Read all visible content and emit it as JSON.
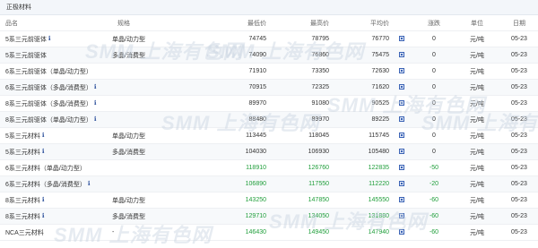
{
  "section": {
    "title": "正极材料"
  },
  "table": {
    "headers": [
      "品名",
      "规格",
      "最低价",
      "最高价",
      "平均价",
      "",
      "涨跌",
      "单位",
      "日期"
    ],
    "icons": {
      "info": "info-icon",
      "chart": "chart-icon"
    },
    "rows": [
      {
        "name": "5系三元前驱体",
        "info": true,
        "spec": "单晶/动力型",
        "low": "74745",
        "high": "78795",
        "avg": "76770",
        "change": "0",
        "unit": "元/吨",
        "date": "05-23",
        "up": false
      },
      {
        "name": "5系三元前驱体",
        "info": false,
        "spec": "多晶/消费型",
        "low": "74090",
        "high": "76860",
        "avg": "75475",
        "change": "0",
        "unit": "元/吨",
        "date": "05-23",
        "up": false
      },
      {
        "name": "6系三元前驱体（单晶/动力型）",
        "info": false,
        "spec": "",
        "low": "71910",
        "high": "73350",
        "avg": "72630",
        "change": "0",
        "unit": "元/吨",
        "date": "05-23",
        "up": false
      },
      {
        "name": "6系三元前驱体（多晶/消费型）",
        "info": true,
        "spec": "",
        "low": "70915",
        "high": "72325",
        "avg": "71620",
        "change": "0",
        "unit": "元/吨",
        "date": "05-23",
        "up": false
      },
      {
        "name": "8系三元前驱体（多晶/消费型）",
        "info": true,
        "spec": "",
        "low": "89970",
        "high": "91080",
        "avg": "90525",
        "change": "0",
        "unit": "元/吨",
        "date": "05-23",
        "up": false
      },
      {
        "name": "8系三元前驱体（单晶/动力型）",
        "info": true,
        "spec": "",
        "low": "88480",
        "high": "89970",
        "avg": "89225",
        "change": "0",
        "unit": "元/吨",
        "date": "05-23",
        "up": false
      },
      {
        "name": "5系三元材料",
        "info": true,
        "spec": "单晶/动力型",
        "low": "113445",
        "high": "118045",
        "avg": "115745",
        "change": "0",
        "unit": "元/吨",
        "date": "05-23",
        "up": false
      },
      {
        "name": "5系三元材料",
        "info": true,
        "spec": "多晶/消费型",
        "low": "104030",
        "high": "106930",
        "avg": "105480",
        "change": "0",
        "unit": "元/吨",
        "date": "05-23",
        "up": false
      },
      {
        "name": "6系三元材料（单晶/动力型）",
        "info": false,
        "spec": "",
        "low": "118910",
        "high": "126760",
        "avg": "122835",
        "change": "-50",
        "unit": "元/吨",
        "date": "05-23",
        "up": true
      },
      {
        "name": "6系三元材料（多晶/消费型）",
        "info": true,
        "spec": "",
        "low": "106890",
        "high": "117550",
        "avg": "112220",
        "change": "-20",
        "unit": "元/吨",
        "date": "05-23",
        "up": true
      },
      {
        "name": "8系三元材料",
        "info": true,
        "spec": "单晶/动力型",
        "low": "143250",
        "high": "147850",
        "avg": "145550",
        "change": "-60",
        "unit": "元/吨",
        "date": "05-23",
        "up": true
      },
      {
        "name": "8系三元材料",
        "info": true,
        "spec": "多晶/消费型",
        "low": "129710",
        "high": "134050",
        "avg": "131880",
        "change": "-60",
        "unit": "元/吨",
        "date": "05-23",
        "up": true
      },
      {
        "name": "NCA三元材料",
        "info": false,
        "spec": "-",
        "low": "146430",
        "high": "149450",
        "avg": "147940",
        "change": "-60",
        "unit": "元/吨",
        "date": "05-23",
        "up": true
      }
    ]
  },
  "watermark": {
    "text": "SMM 上海有色网"
  }
}
